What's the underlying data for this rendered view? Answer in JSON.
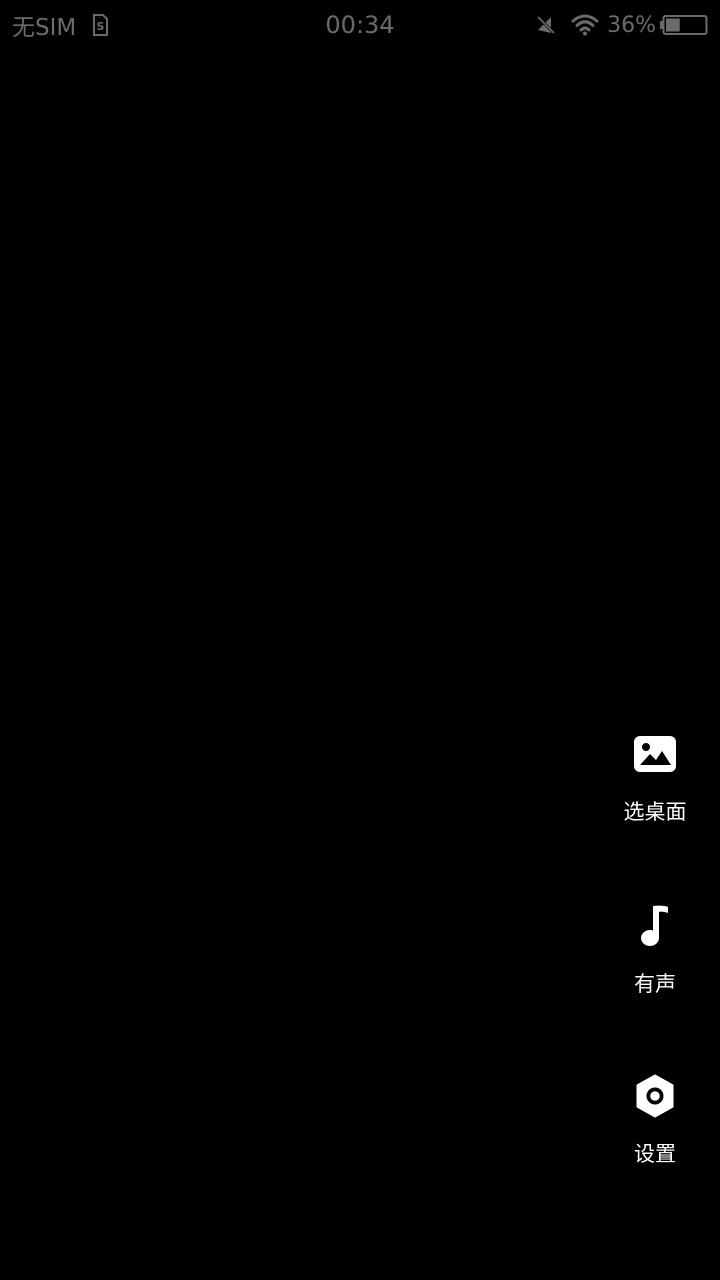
{
  "status_bar": {
    "carrier": "无SIM",
    "time": "00:34",
    "battery_percent": "36%",
    "battery_level": 0.36,
    "icons": [
      "sim-card-icon",
      "mute-icon",
      "wifi-icon",
      "battery-icon"
    ]
  },
  "side_actions": [
    {
      "label": "选桌面",
      "icon": "image-icon"
    },
    {
      "label": "有声",
      "icon": "music-note-icon"
    },
    {
      "label": "设置",
      "icon": "settings-hex-icon"
    }
  ],
  "colors": {
    "background": "#000000",
    "status_text": "#6b6b6b",
    "action_icon": "#ffffff",
    "action_label": "#ffffff"
  }
}
